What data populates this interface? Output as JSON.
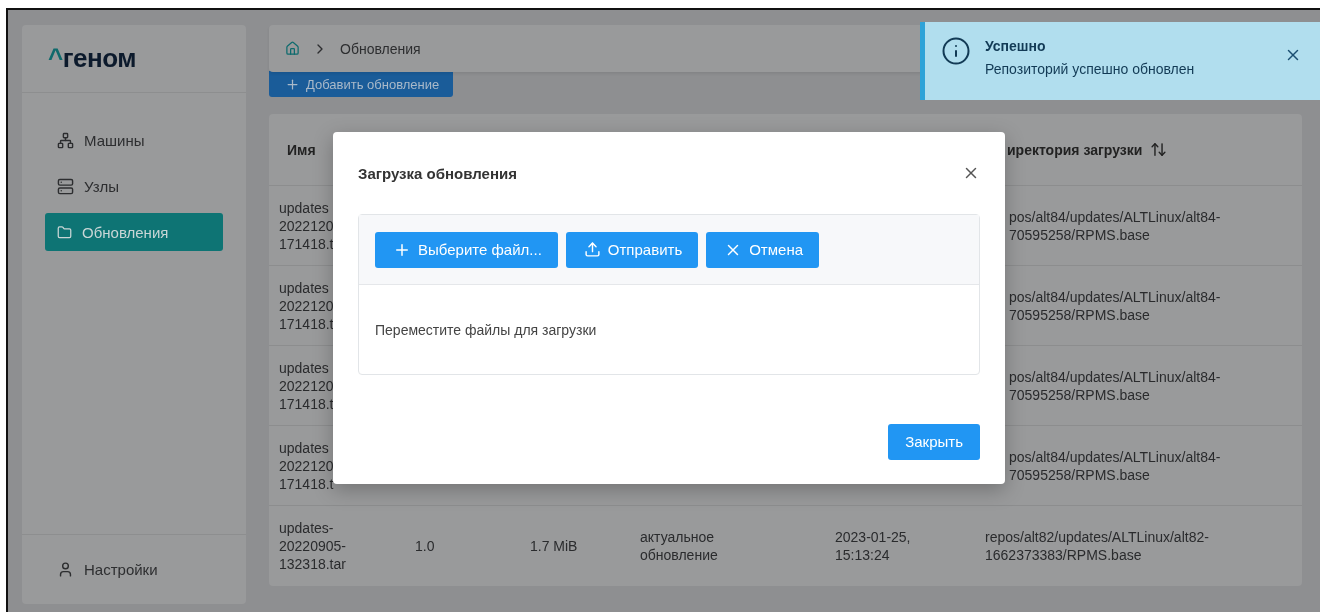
{
  "sidebar": {
    "logo": {
      "mark": "^",
      "text": "геном"
    },
    "items": [
      {
        "kind": "machines",
        "label": "Машины",
        "selected": false
      },
      {
        "kind": "nodes",
        "label": "Узлы",
        "selected": false
      },
      {
        "kind": "updates",
        "label": "Обновления",
        "selected": true
      }
    ],
    "footer": {
      "label": "Настройки"
    }
  },
  "breadcrumb": {
    "current": "Обновления"
  },
  "add_button": "Добавить обновление",
  "table": {
    "header": {
      "name": "Имя",
      "column_6": "иректория загрузки"
    },
    "rows": [
      {
        "kind": "partial",
        "name": "updates\n2022120\n171418.t",
        "directory": "pos/alt84/updates/ALTLinux/alt84-\n70595258/RPMS.base"
      },
      {
        "kind": "partial",
        "name": "updates\n2022120\n171418.t",
        "directory": "pos/alt84/updates/ALTLinux/alt84-\n70595258/RPMS.base"
      },
      {
        "kind": "partial",
        "name": "updates\n2022120\n171418.t",
        "directory": "pos/alt84/updates/ALTLinux/alt84-\n70595258/RPMS.base"
      },
      {
        "kind": "partial",
        "name": "updates\n2022120\n171418.t",
        "directory": "pos/alt84/updates/ALTLinux/alt84-\n70595258/RPMS.base"
      },
      {
        "kind": "full",
        "name": "updates-\n20220905-\n132318.tar",
        "version": "1.0",
        "size": "1.7 MiB",
        "status": "актуальное\nобновление",
        "date": "2023-01-25,\n15:13:24",
        "directory": "repos/alt82/updates/ALTLinux/alt82-\n1662373383/RPMS.base"
      }
    ]
  },
  "modal": {
    "title": "Загрузка обновления",
    "buttons": [
      {
        "kind": "choose",
        "label": "Выберите файл..."
      },
      {
        "kind": "upload",
        "label": "Отправить"
      },
      {
        "kind": "cancel",
        "label": "Отмена"
      }
    ],
    "dropzone_text": "Переместите файлы для загрузки",
    "close_button": "Закрыть"
  },
  "toast": {
    "title": "Успешно",
    "message": "Репозиторий успешно обновлен"
  }
}
